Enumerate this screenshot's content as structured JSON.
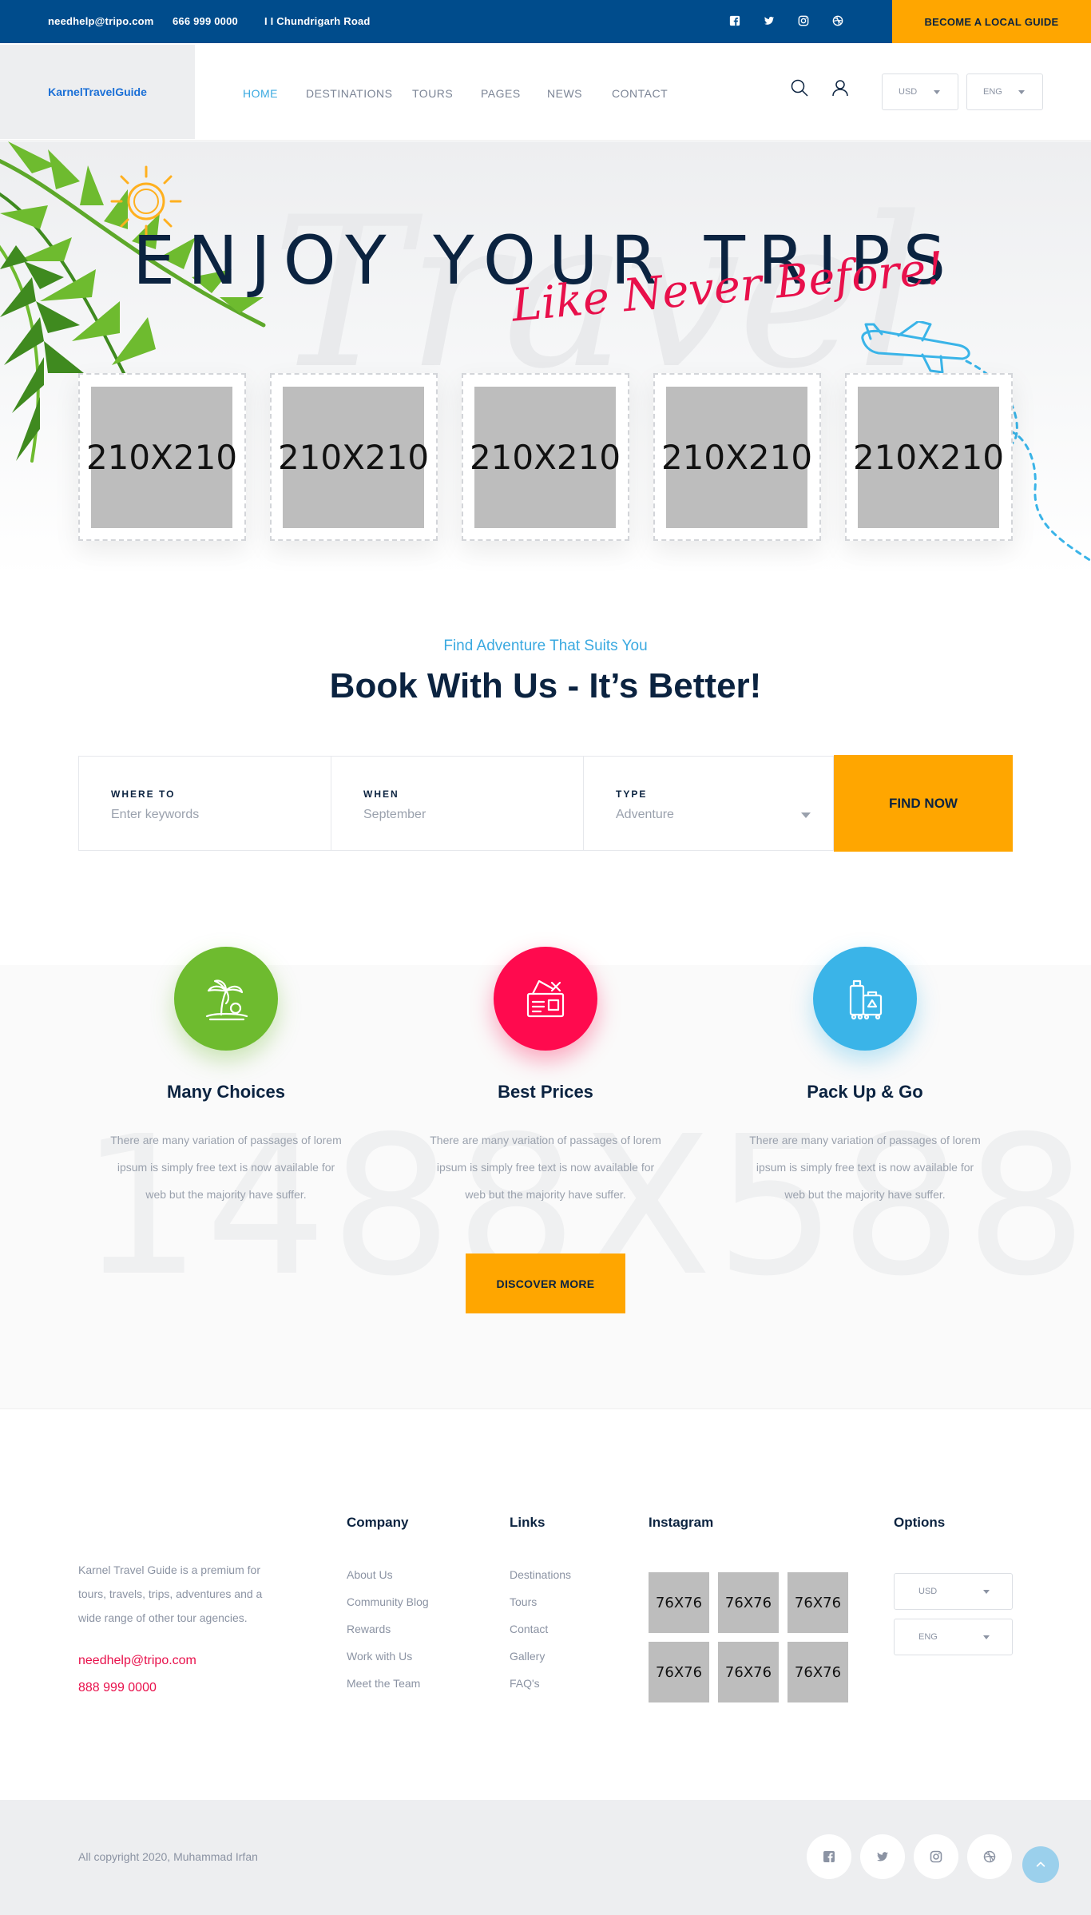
{
  "topbar": {
    "email": "needhelp@tripo.com",
    "phone": "666 999 0000",
    "address": "I I Chundrigarh Road",
    "social_icons": [
      "facebook-icon",
      "twitter-icon",
      "instagram-icon",
      "dribbble-icon"
    ],
    "guide_button": "BECOME A LOCAL GUIDE"
  },
  "header": {
    "logo": "KarnelTravelGuide",
    "nav": [
      "HOME",
      "DESTINATIONS",
      "TOURS",
      "PAGES",
      "NEWS",
      "CONTACT"
    ],
    "active_nav": "HOME",
    "currency": "USD",
    "language": "ENG"
  },
  "hero": {
    "watermark": "Travel",
    "title": "ENJOY YOUR TRIPS",
    "script": "Like Never Before!",
    "cards": [
      "210X210",
      "210X210",
      "210X210",
      "210X210",
      "210X210"
    ]
  },
  "booking": {
    "subtitle": "Find Adventure That Suits You",
    "title": "Book With Us - It’s Better!",
    "fields": [
      {
        "label": "WHERE TO",
        "placeholder": "Enter keywords"
      },
      {
        "label": "WHEN",
        "placeholder": "September"
      },
      {
        "label": "TYPE",
        "value": "Adventure"
      }
    ],
    "button": "FIND NOW"
  },
  "features": {
    "watermark": "1488X588",
    "items": [
      {
        "title": "Many Choices",
        "text": "There are many variation of passages of lorem ipsum is simply free text is now available for web but the majority have suffer.",
        "color": "#6ebb2f",
        "icon": "island-icon"
      },
      {
        "title": "Best Prices",
        "text": "There are many variation of passages of lorem ipsum is simply free text is now available for web but the majority have suffer.",
        "color": "#ff0a4e",
        "icon": "ticket-icon"
      },
      {
        "title": "Pack Up & Go",
        "text": "There are many variation of passages of lorem ipsum is simply free text is now available for web but the majority have suffer.",
        "color": "#3ab4e8",
        "icon": "luggage-icon"
      }
    ],
    "button": "DISCOVER MORE"
  },
  "footer": {
    "about": "Karnel Travel Guide is a premium for tours, travels, trips, adventures and a wide range of other tour agencies.",
    "email": "needhelp@tripo.com",
    "phone": "888 999 0000",
    "company_title": "Company",
    "company_links": [
      "About Us",
      "Community Blog",
      "Rewards",
      "Work with Us",
      "Meet the Team"
    ],
    "links_title": "Links",
    "links": [
      "Destinations",
      "Tours",
      "Contact",
      "Gallery",
      "FAQ's"
    ],
    "instagram_title": "Instagram",
    "instagram": [
      "76X76",
      "76X76",
      "76X76",
      "76X76",
      "76X76",
      "76X76"
    ],
    "options_title": "Options",
    "currency": "USD",
    "language": "ENG"
  },
  "bottom": {
    "copyright": "All copyright 2020, Muhammad Irfan"
  },
  "colors": {
    "navy": "#004c8c",
    "accent": "#ffa600",
    "pink": "#e8104b",
    "blue": "#3aa9e0",
    "green": "#6ebb2f"
  }
}
